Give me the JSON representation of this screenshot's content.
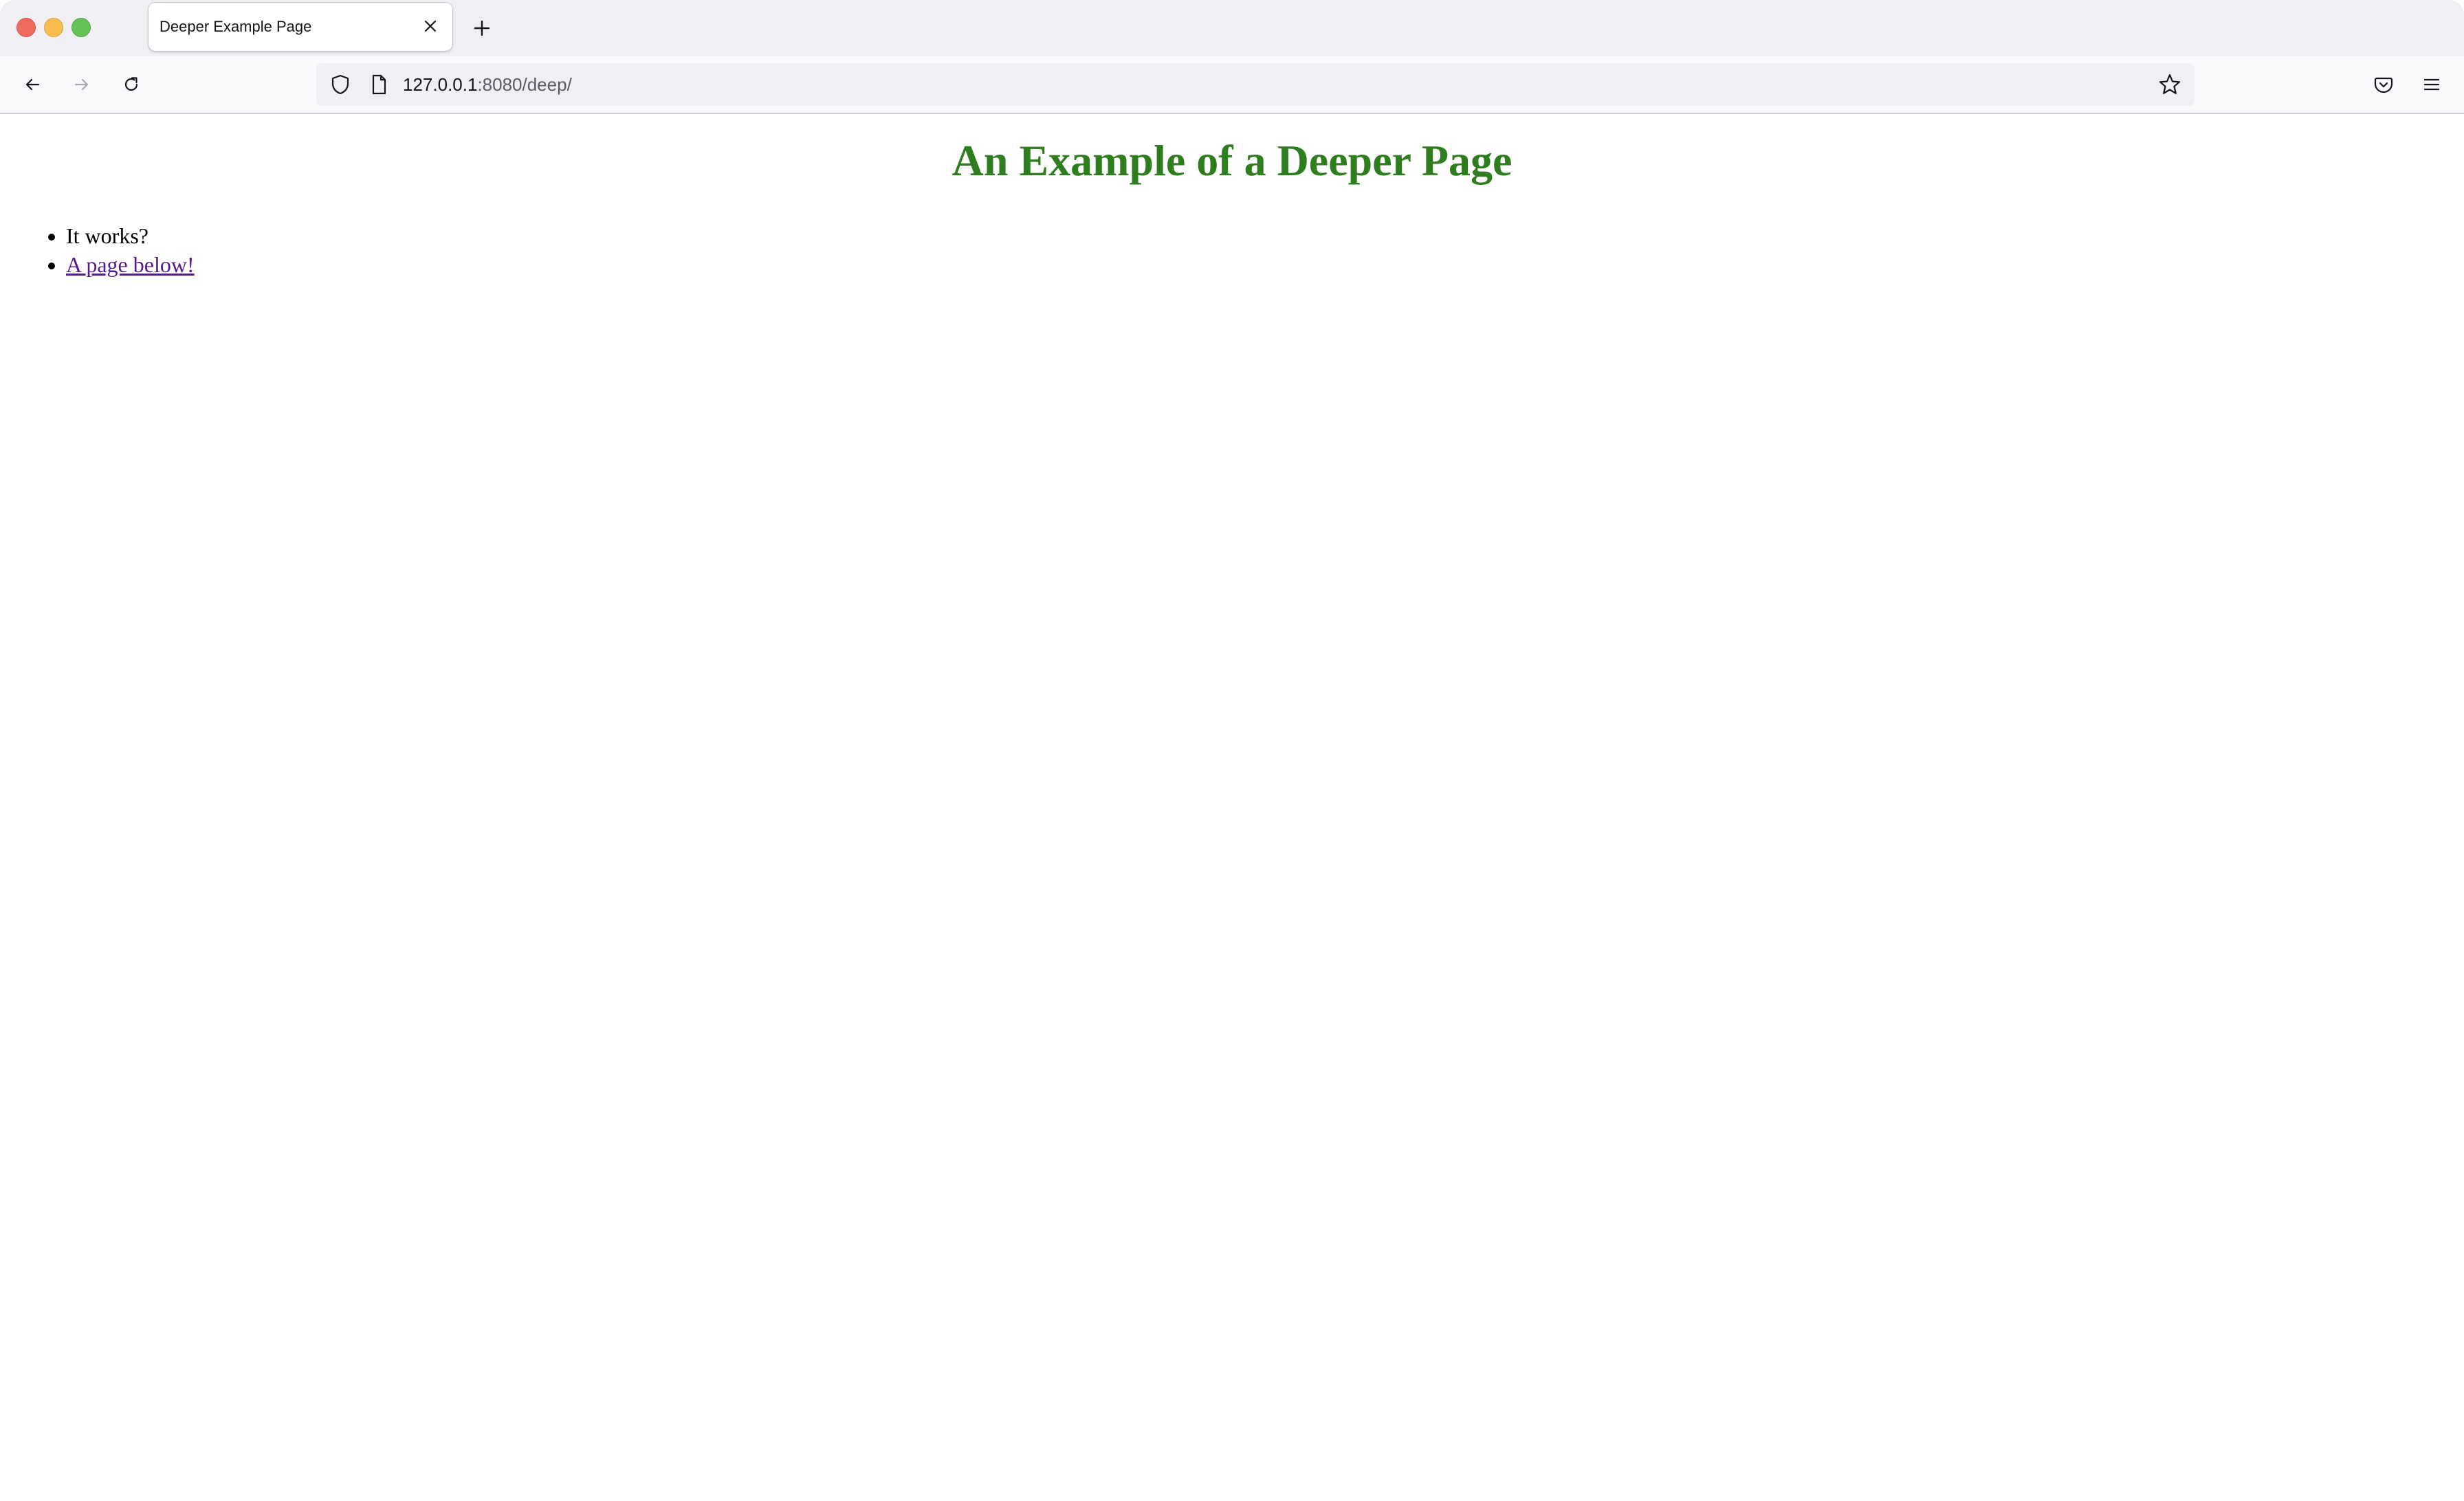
{
  "browser": {
    "tab": {
      "title": "Deeper Example Page",
      "close_icon": "close-icon"
    },
    "new_tab_icon": "plus-icon",
    "nav": {
      "back_icon": "arrow-left-icon",
      "forward_icon": "arrow-right-icon",
      "reload_icon": "reload-icon"
    },
    "url": {
      "host": "127.0.0.1",
      "path": ":8080/deep/",
      "shield_icon": "shield-icon",
      "page_icon": "page-icon",
      "bookmark_icon": "star-icon"
    },
    "toolbar": {
      "pocket_icon": "pocket-icon",
      "menu_icon": "hamburger-menu-icon"
    }
  },
  "page": {
    "heading": "An Example of a Deeper Page",
    "heading_color": "#2e7d1e",
    "list": [
      {
        "text": "It works?",
        "is_link": false
      },
      {
        "text": "A page below!",
        "is_link": true,
        "link_color": "#551a8b"
      }
    ]
  }
}
